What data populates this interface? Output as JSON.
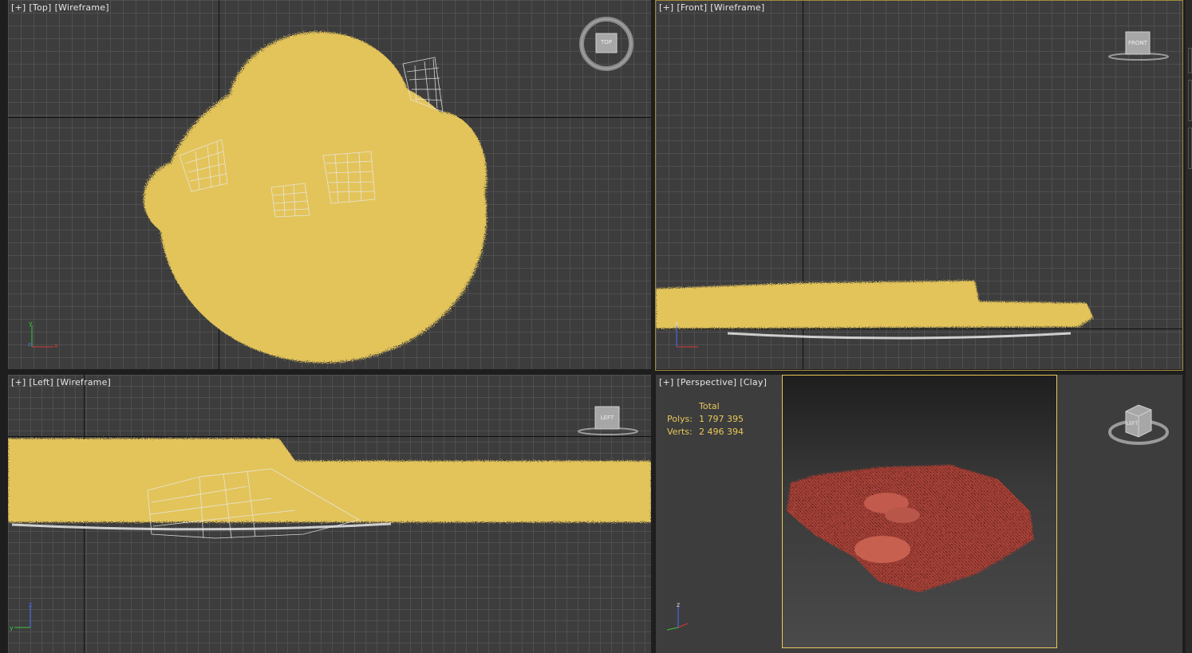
{
  "viewports": {
    "top": {
      "plus": "[+]",
      "view": "[Top]",
      "mode": "[Wireframe]",
      "cube_label": "TOP"
    },
    "front": {
      "plus": "[+]",
      "view": "[Front]",
      "mode": "[Wireframe]",
      "cube_label": "FRONT"
    },
    "left": {
      "plus": "[+]",
      "view": "[Left]",
      "mode": "[Wireframe]",
      "cube_label": "LEFT"
    },
    "perspective": {
      "plus": "[+]",
      "view": "[Perspective]",
      "mode": "[Clay]",
      "cube_label": "LEFT",
      "stats": {
        "header": "Total",
        "polys_label": "Polys:",
        "polys_value": "1 797 395",
        "verts_label": "Verts:",
        "verts_value": "2 496 394"
      }
    }
  },
  "axes": {
    "x": "x",
    "y": "y",
    "z": "z"
  },
  "colors": {
    "grass": "#e3c45a",
    "wire": "#e8e8e8",
    "clay": "#b84a3f",
    "viewport_bg": "#3d3d3d",
    "active_border": "#a08a3c",
    "stats_text": "#e8c75a"
  }
}
